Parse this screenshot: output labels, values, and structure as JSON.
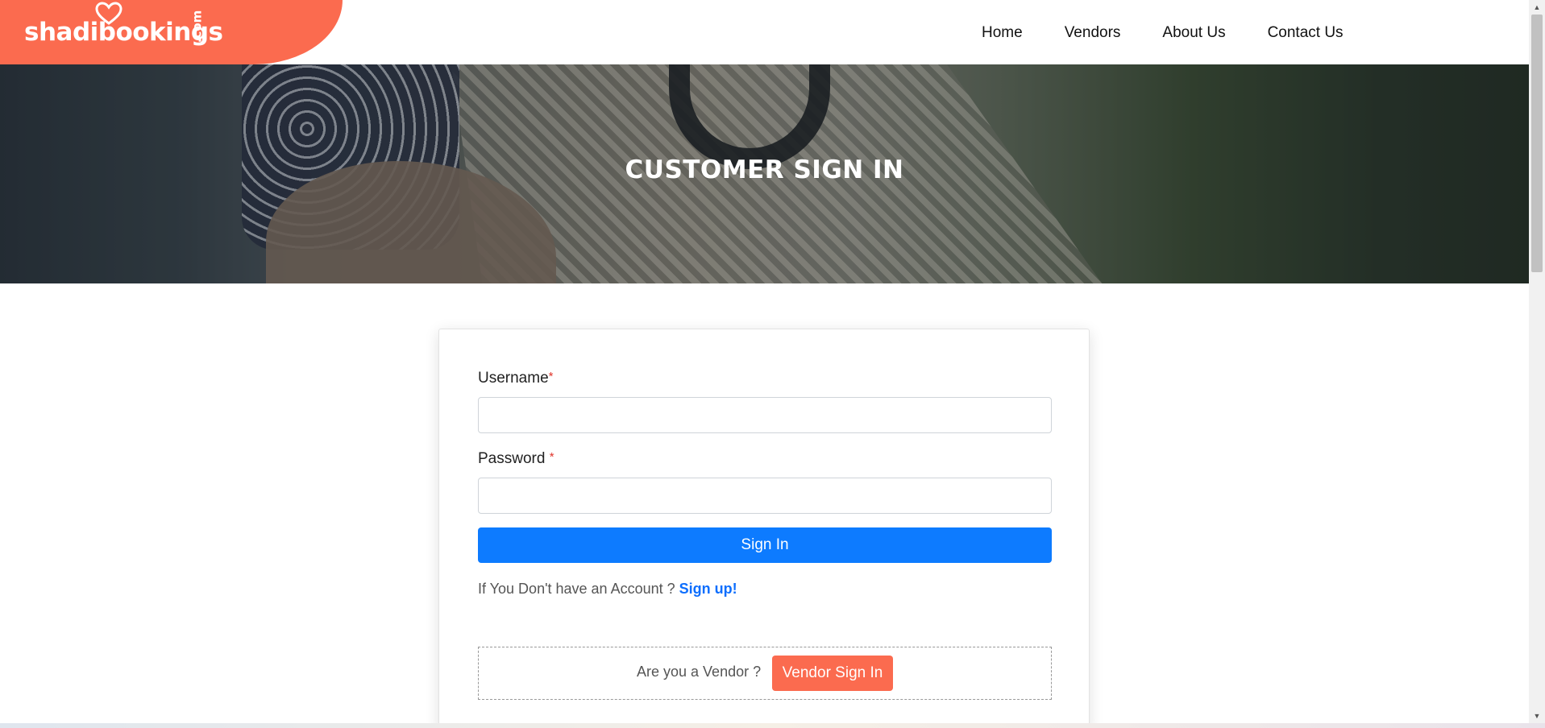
{
  "brand": {
    "name": "shadibookings",
    "suffix": ".com",
    "color": "#fb6b4f"
  },
  "nav": {
    "items": [
      "Home",
      "Vendors",
      "About Us",
      "Contact Us"
    ]
  },
  "hero": {
    "title": "CUSTOMER SIGN IN"
  },
  "form": {
    "username_label": "Username",
    "password_label": "Password",
    "required_mark": "*",
    "username_value": "",
    "password_value": "",
    "signin_label": "Sign In",
    "signup_prompt": "If You Don't have an Account ?",
    "signup_link": "Sign up!",
    "vendor_prompt": "Are you a Vendor ?",
    "vendor_button": "Vendor Sign In",
    "primary_color": "#0d7bff"
  }
}
